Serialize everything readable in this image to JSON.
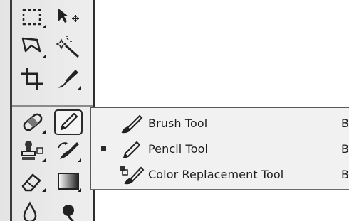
{
  "tools_flyout": {
    "items": [
      {
        "label": "Brush Tool",
        "shortcut": "B",
        "icon": "brush-icon",
        "selected": false
      },
      {
        "label": "Pencil Tool",
        "shortcut": "B",
        "icon": "pencil-icon",
        "selected": true
      },
      {
        "label": "Color Replacement Tool",
        "shortcut": "B",
        "icon": "color-replacement-icon",
        "selected": false
      }
    ]
  },
  "toolbox": {
    "tools": [
      {
        "icon": "rectangular-marquee-icon"
      },
      {
        "icon": "move-icon"
      },
      {
        "icon": "lasso-icon"
      },
      {
        "icon": "magic-wand-icon"
      },
      {
        "icon": "crop-icon"
      },
      {
        "icon": "slice-icon"
      },
      {
        "icon": "healing-brush-icon"
      },
      {
        "icon": "pencil-icon",
        "active": true
      },
      {
        "icon": "clone-stamp-icon"
      },
      {
        "icon": "history-brush-icon"
      },
      {
        "icon": "eraser-icon"
      },
      {
        "icon": "gradient-icon"
      },
      {
        "icon": "blur-icon"
      },
      {
        "icon": "dodge-icon"
      }
    ]
  }
}
